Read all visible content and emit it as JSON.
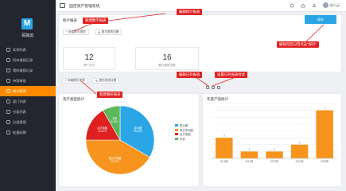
{
  "app": {
    "logo_letter": "M",
    "logo_text": "码如云",
    "system_title": "固定资产管理系统"
  },
  "sidebar": {
    "items": [
      {
        "label": "实例列表",
        "icon": "list-icon"
      },
      {
        "label": "所有填报记录",
        "icon": "records-icon"
      },
      {
        "label": "我的填报记录",
        "icon": "my-records-icon"
      },
      {
        "label": "待我审批",
        "icon": "approval-icon"
      },
      {
        "label": "统计报表",
        "icon": "chart-icon",
        "active": true
      },
      {
        "label": "部门列表",
        "icon": "department-icon"
      },
      {
        "label": "分组列表",
        "icon": "group-icon"
      },
      {
        "label": "分组管理",
        "icon": "group-manage-icon"
      },
      {
        "label": "批量码牌",
        "icon": "batch-qr-icon"
      }
    ]
  },
  "topbar": {
    "user": "陆小云"
  },
  "stats_panel": {
    "title": "统计报表",
    "add_numeric_btn": "+ 新建数字报表",
    "numeric_settings_btn": "数字报表设置",
    "save_btn": "保存",
    "cards": [
      {
        "value": "12",
        "label": "资产总计"
      },
      {
        "value": "16",
        "label": "累计报修次数"
      }
    ]
  },
  "chart_toolbar": {
    "add_chart_btn": "+ 新建图形报表",
    "chart_settings_btn": "图形报表设置"
  },
  "callouts": {
    "edit_stats": "编辑统计报表",
    "new_numeric": "新建数字报表",
    "new_chart": "新建图形报表",
    "edit_existing": "编辑已有报表",
    "set_style": "设置已有报表样式",
    "save_hint": "编辑完后记得点击\"保存\""
  },
  "chart_data": [
    {
      "type": "pie",
      "title": "资产类型统计",
      "slices": [
        {
          "name": "显示器",
          "value": 33.33,
          "label_name": "显示器",
          "label_value": "33.33%",
          "color": "#2aa6e6"
        },
        {
          "name": "笔记本电脑",
          "value": 41.67,
          "label_name": "笔记本电脑",
          "label_value": "41.67%",
          "color": "#f7941d"
        },
        {
          "name": "台式电脑",
          "value": 16.67,
          "label_name": "台式电脑",
          "label_value": "16.67%",
          "color": "#e02020"
        },
        {
          "name": "手机",
          "value": 8.33,
          "label_name": "手机",
          "label_value": "8.33%",
          "color": "#5cb85c"
        }
      ],
      "legend": [
        "显示器",
        "笔记本电脑",
        "台式电脑",
        "手机"
      ]
    },
    {
      "type": "bar",
      "title": "年度产值统计",
      "categories": [
        "2018年",
        "2019年",
        "2020年",
        "2021年",
        "2022年"
      ],
      "values": [
        3,
        1,
        1,
        2,
        7
      ],
      "ylim": [
        0,
        8
      ],
      "grid": true,
      "color": "#f7941d"
    }
  ]
}
